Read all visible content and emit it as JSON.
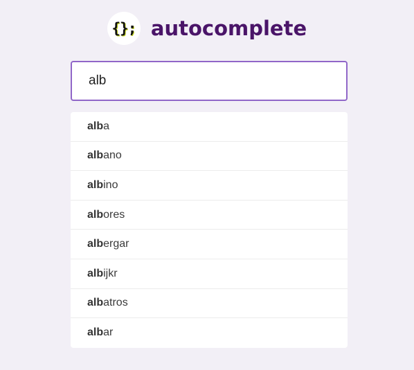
{
  "header": {
    "logo_text": "{};",
    "title": "autocomplete",
    "colors": {
      "title": "#4a1468",
      "border": "#9066c8",
      "background": "#f2eff6"
    }
  },
  "search": {
    "value": "alb"
  },
  "suggestions": [
    {
      "match": "alb",
      "rest": "a"
    },
    {
      "match": "alb",
      "rest": "ano"
    },
    {
      "match": "alb",
      "rest": "ino"
    },
    {
      "match": "alb",
      "rest": "ores"
    },
    {
      "match": "alb",
      "rest": "ergar"
    },
    {
      "match": "alb",
      "rest": "ijkr"
    },
    {
      "match": "alb",
      "rest": "atros"
    },
    {
      "match": "alb",
      "rest": "ar"
    }
  ]
}
